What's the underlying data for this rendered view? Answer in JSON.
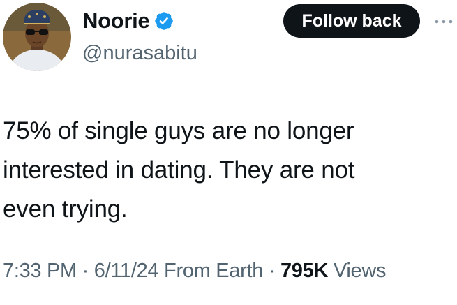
{
  "author": {
    "display_name": "Noorie",
    "handle": "@nurasabitu",
    "verified": true
  },
  "actions": {
    "follow_label": "Follow back"
  },
  "tweet": {
    "text": "75% of single guys are no longer\ninterested in dating. They are not\neven trying."
  },
  "meta": {
    "time": "7:33 PM",
    "sep1": " · ",
    "date": "6/11/24",
    "source": " From Earth",
    "sep2": " · ",
    "views_count": "795K",
    "views_label": " Views"
  },
  "colors": {
    "text_primary": "#0f1419",
    "text_secondary": "#536471",
    "verified_badge": "#1d9bf0",
    "button_bg": "#0f1419",
    "button_text": "#ffffff"
  },
  "icons": {
    "verified": "verified-badge-icon",
    "more": "more-options-icon"
  }
}
